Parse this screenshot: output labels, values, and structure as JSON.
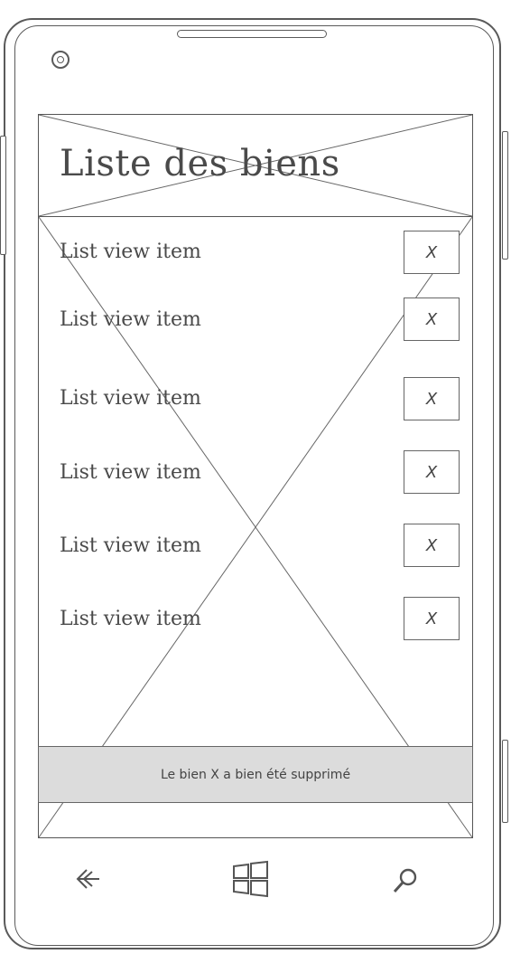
{
  "header": {
    "title": "Liste des biens"
  },
  "list": {
    "items": [
      {
        "label": "List view item",
        "delete_label": "X"
      },
      {
        "label": "List view item",
        "delete_label": "X"
      },
      {
        "label": "List view item",
        "delete_label": "X"
      },
      {
        "label": "List view item",
        "delete_label": "X"
      },
      {
        "label": "List view item",
        "delete_label": "X"
      },
      {
        "label": "List view item",
        "delete_label": "X"
      }
    ]
  },
  "toast": {
    "message": "Le bien X a bien été supprimé"
  },
  "navbar": {
    "icons": [
      "back-arrow-icon",
      "windows-start-icon",
      "search-icon"
    ]
  }
}
